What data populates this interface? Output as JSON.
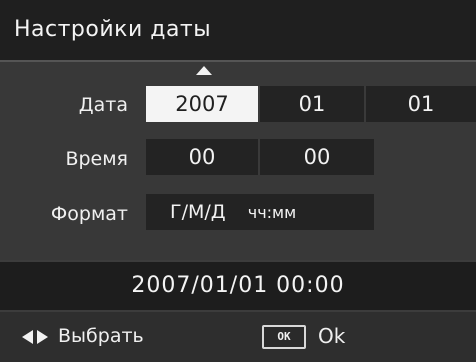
{
  "header": {
    "title": "Настройки даты"
  },
  "date_row": {
    "label": "Дата",
    "year": "2007",
    "month": "01",
    "day": "01",
    "selected_field": "year"
  },
  "time_row": {
    "label": "Время",
    "hour": "00",
    "minute": "00"
  },
  "format_row": {
    "label": "Формат",
    "date_format": "Г/М/Д",
    "time_format": "чч:мм"
  },
  "preview": {
    "text": "2007/01/01 00:00"
  },
  "footer": {
    "select_icon": "left-right-arrows-icon",
    "select_label": "Выбрать",
    "ok_key_label": "OK",
    "ok_label": "Ok"
  },
  "colors": {
    "background": "#3c3c3c",
    "cell": "#232323",
    "selected_cell": "#f4f4f4",
    "text": "#f2f2f2"
  }
}
